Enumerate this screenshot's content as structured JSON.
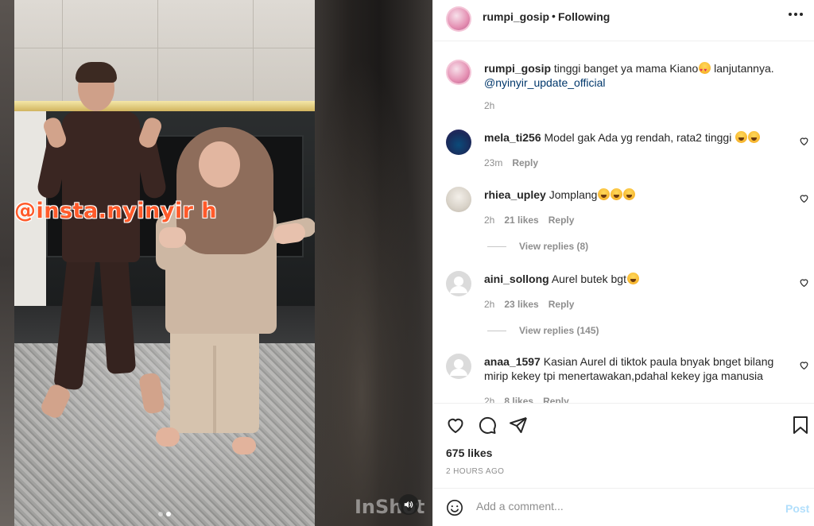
{
  "media": {
    "overlay_text": "@insta.nyinyir h",
    "watermark": "InShot",
    "carousel_dots": 2,
    "active_dot": 1
  },
  "header": {
    "username": "rumpi_gosip",
    "separator": "•",
    "follow_status": "Following"
  },
  "caption": {
    "username": "rumpi_gosip",
    "text": "tinggi banget ya mama Kiano",
    "text_after": " lanjutannya.",
    "mention": "@nyinyir_update_official",
    "time": "2h"
  },
  "comments": [
    {
      "username": "mela_ti256",
      "text": "Model gak Ada yg rendah, rata2 tinggi ",
      "time": "23m",
      "likes": "",
      "reply": "Reply",
      "view_replies": ""
    },
    {
      "username": "rhiea_upley",
      "text": "Jomplang",
      "time": "2h",
      "likes": "21 likes",
      "reply": "Reply",
      "view_replies": "View replies (8)"
    },
    {
      "username": "aini_sollong",
      "text": "Aurel butek bgt",
      "time": "2h",
      "likes": "23 likes",
      "reply": "Reply",
      "view_replies": "View replies (145)"
    },
    {
      "username": "anaa_1597",
      "text": "Kasian Aurel di tiktok paula bnyak bnget bilang mirip kekey tpi menertawakan,pdahal kekey jga manusia",
      "time": "2h",
      "likes": "8 likes",
      "reply": "Reply",
      "view_replies": ""
    }
  ],
  "actions": {
    "likes": "675 likes",
    "time_ago": "2 HOURS AGO",
    "comment_placeholder": "Add a comment...",
    "post_label": "Post"
  },
  "colors": {
    "overlay_text": "#ff5a2a",
    "link": "#00376b",
    "post_disabled": "#b2dffc",
    "muted": "#8e8e8e"
  }
}
